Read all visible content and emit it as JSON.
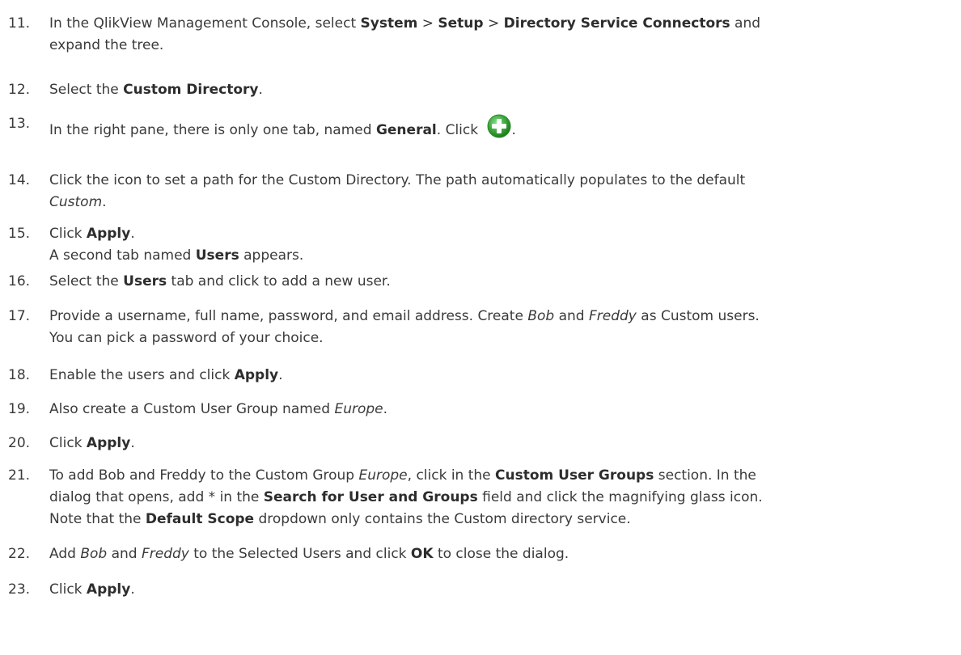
{
  "steps": [
    {
      "number": "11.",
      "lines": [
        [
          {
            "t": "In the QlikView Management Console, select ",
            "s": "n"
          },
          {
            "t": "System",
            "s": "b"
          },
          {
            "t": " > ",
            "s": "n"
          },
          {
            "t": "Setup",
            "s": "b"
          },
          {
            "t": " > ",
            "s": "n"
          },
          {
            "t": "Directory Service Connectors",
            "s": "b"
          },
          {
            "t": " and",
            "s": "n"
          }
        ],
        [
          {
            "t": "expand the tree.",
            "s": "n"
          }
        ]
      ]
    },
    {
      "number": "12.",
      "lines": [
        [
          {
            "t": "Select the ",
            "s": "n"
          },
          {
            "t": "Custom Directory",
            "s": "b"
          },
          {
            "t": ".",
            "s": "n"
          }
        ]
      ]
    },
    {
      "number": "13.",
      "lines": [
        [
          {
            "t": "In the right pane, there is only one tab, named ",
            "s": "n"
          },
          {
            "t": "General",
            "s": "b"
          },
          {
            "t": ". Click ",
            "s": "n"
          },
          {
            "icon": "add-green-plus-icon"
          },
          {
            "t": ".",
            "s": "n"
          }
        ]
      ]
    },
    {
      "number": "14.",
      "lines": [
        [
          {
            "t": "Click the icon to set a path for the Custom Directory. The path automatically populates to the default",
            "s": "n"
          }
        ],
        [
          {
            "t": "Custom",
            "s": "i"
          },
          {
            "t": ".",
            "s": "n"
          }
        ]
      ]
    },
    {
      "number": "15.",
      "lines": [
        [
          {
            "t": "Click ",
            "s": "n"
          },
          {
            "t": "Apply",
            "s": "b"
          },
          {
            "t": ".",
            "s": "n"
          }
        ],
        [
          {
            "t": "A second tab named ",
            "s": "n"
          },
          {
            "t": "Users",
            "s": "b"
          },
          {
            "t": " appears.",
            "s": "n"
          }
        ]
      ]
    },
    {
      "number": "16.",
      "lines": [
        [
          {
            "t": "Select the ",
            "s": "n"
          },
          {
            "t": "Users",
            "s": "b"
          },
          {
            "t": " tab and click to add a new user.",
            "s": "n"
          }
        ]
      ]
    },
    {
      "number": "17.",
      "lines": [
        [
          {
            "t": "Provide a username, full name, password, and email address. Create ",
            "s": "n"
          },
          {
            "t": "Bob",
            "s": "i"
          },
          {
            "t": " and ",
            "s": "n"
          },
          {
            "t": "Freddy",
            "s": "i"
          },
          {
            "t": " as Custom users.",
            "s": "n"
          }
        ],
        [
          {
            "t": "You can pick a password of your choice.",
            "s": "n"
          }
        ]
      ]
    },
    {
      "number": "18.",
      "lines": [
        [
          {
            "t": "Enable the users and click ",
            "s": "n"
          },
          {
            "t": "Apply",
            "s": "b"
          },
          {
            "t": ".",
            "s": "n"
          }
        ]
      ]
    },
    {
      "number": "19.",
      "lines": [
        [
          {
            "t": "Also create a Custom User Group named ",
            "s": "n"
          },
          {
            "t": "Europe",
            "s": "i"
          },
          {
            "t": ".",
            "s": "n"
          }
        ]
      ]
    },
    {
      "number": "20.",
      "lines": [
        [
          {
            "t": "Click ",
            "s": "n"
          },
          {
            "t": "Apply",
            "s": "b"
          },
          {
            "t": ".",
            "s": "n"
          }
        ]
      ]
    },
    {
      "number": "21.",
      "lines": [
        [
          {
            "t": "To add Bob and Freddy to the Custom Group ",
            "s": "n"
          },
          {
            "t": "Europe",
            "s": "i"
          },
          {
            "t": ", click in the ",
            "s": "n"
          },
          {
            "t": "Custom User Groups",
            "s": "b"
          },
          {
            "t": " section. In the",
            "s": "n"
          }
        ],
        [
          {
            "t": "dialog that opens, add * in the ",
            "s": "n"
          },
          {
            "t": "Search for User and Groups",
            "s": "b"
          },
          {
            "t": " field and click the magnifying glass icon.",
            "s": "n"
          }
        ],
        [
          {
            "t": "Note that the ",
            "s": "n"
          },
          {
            "t": "Default Scope",
            "s": "b"
          },
          {
            "t": " dropdown only contains the Custom directory service.",
            "s": "n"
          }
        ]
      ]
    },
    {
      "number": "22.",
      "lines": [
        [
          {
            "t": "Add ",
            "s": "n"
          },
          {
            "t": "Bob",
            "s": "i"
          },
          {
            "t": " and ",
            "s": "n"
          },
          {
            "t": "Freddy",
            "s": "i"
          },
          {
            "t": " to the Selected Users and click ",
            "s": "n"
          },
          {
            "t": "OK",
            "s": "b"
          },
          {
            "t": " to close the dialog.",
            "s": "n"
          }
        ]
      ]
    },
    {
      "number": "23.",
      "lines": [
        [
          {
            "t": "Click ",
            "s": "n"
          },
          {
            "t": "Apply",
            "s": "b"
          },
          {
            "t": ".",
            "s": "n"
          }
        ]
      ]
    }
  ],
  "colors": {
    "text": "#3a3a3a",
    "plus_icon_green": "#3aa53a"
  }
}
